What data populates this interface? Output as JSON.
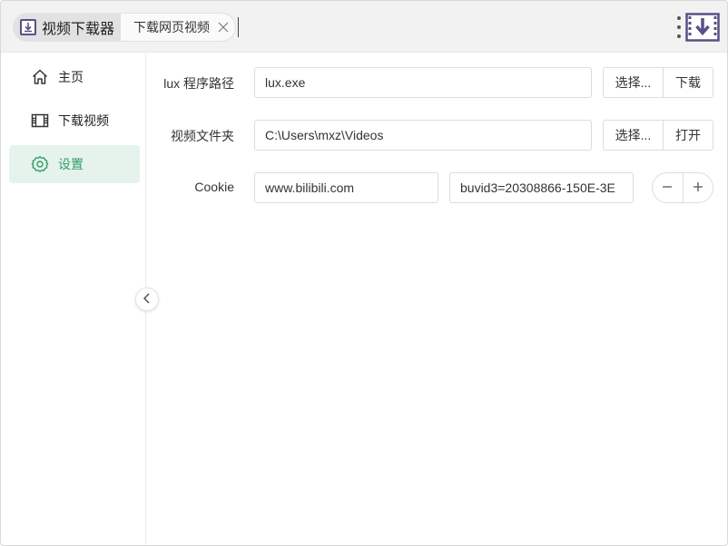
{
  "app": {
    "title": "视频下载器",
    "icon": "download-box-icon"
  },
  "tabs": [
    {
      "label": "下载网页视频"
    }
  ],
  "sidebar": {
    "items": [
      {
        "label": "主页",
        "icon": "home-icon",
        "active": false
      },
      {
        "label": "下载视频",
        "icon": "film-icon",
        "active": false
      },
      {
        "label": "设置",
        "icon": "gear-icon",
        "active": true
      }
    ]
  },
  "settings": {
    "lux_path": {
      "label": "lux 程序路径",
      "value": "lux.exe",
      "select_label": "选择...",
      "download_label": "下载"
    },
    "video_folder": {
      "label": "视频文件夹",
      "value": "C:\\Users\\mxz\\Videos",
      "select_label": "选择...",
      "open_label": "打开"
    },
    "cookie": {
      "label": "Cookie",
      "domain_value": "www.bilibili.com",
      "cookie_value": "buvid3=20308866-150E-3E",
      "minus_label": "−",
      "plus_label": "+"
    }
  },
  "colors": {
    "accent": "#2f9e69",
    "accent_bg": "#e6f3ec",
    "brand_purple": "#5a4f86"
  }
}
